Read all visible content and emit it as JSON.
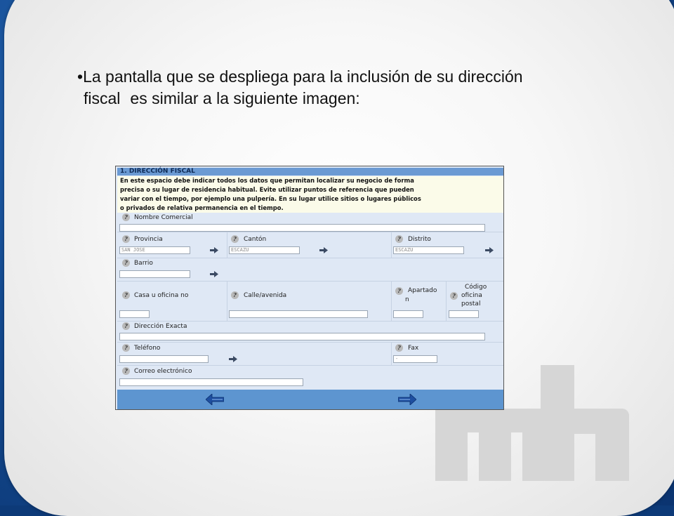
{
  "slide": {
    "bullet": "•",
    "line1": "La pantalla que se despliega para la inclusión de su dirección",
    "line2a": "fiscal",
    "line2b": "es similar a la siguiente imagen:"
  },
  "form": {
    "section_title": "1. DIRECCIÓN FISCAL",
    "intro_lines": [
      "En este espacio debe indicar todos los datos que permitan localizar su negocio de forma",
      "precisa o su lugar de residencia habitual. Evite utilizar puntos de referencia que pueden",
      "variar con el tiempo, por ejemplo una pulpería. En su lugar utilice sitios o lugares públicos",
      "o privados de relativa permanencia en el tiempo."
    ],
    "help_glyph": "?",
    "labels": {
      "nombre_comercial": "Nombre Comercial",
      "provincia": "Provincia",
      "canton": "Cantón",
      "distrito": "Distrito",
      "barrio": "Barrio",
      "casa": "Casa u oficina no",
      "calle": "Calle/avenida",
      "apartado_1": "Apartado",
      "apartado_2": "n",
      "codigo_1": "Código",
      "codigo_2": "oficina",
      "codigo_3": "postal",
      "direccion_exacta": "Dirección Exacta",
      "telefono": "Teléfono",
      "fax": "Fax",
      "correo": "Correo electrónico"
    },
    "values": {
      "provincia": "SAN JOSE",
      "canton": "ESCAZU",
      "distrito": "ESCAZU",
      "fax": "-"
    },
    "colors": {
      "header": "#6b9ad3",
      "intro_bg": "#fbfbe9",
      "form_bg": "#dfe8f5",
      "footer": "#5d95d0"
    },
    "icons": [
      "help-icon",
      "picker-arrow-icon",
      "back-arrow-icon",
      "forward-arrow-icon"
    ]
  },
  "logo": "mh"
}
